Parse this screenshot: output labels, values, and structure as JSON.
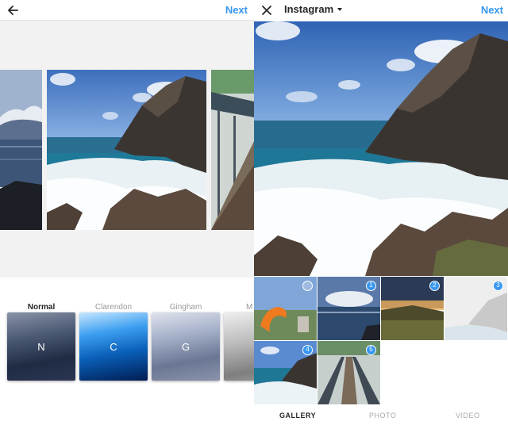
{
  "colors": {
    "accent": "#3897f0",
    "text": "#262626",
    "muted": "#9a9a9a"
  },
  "editor": {
    "back_icon": "arrow-left-icon",
    "next_label": "Next",
    "filters": [
      {
        "name": "Normal",
        "letter": "N"
      },
      {
        "name": "Clarendon",
        "letter": "C"
      },
      {
        "name": "Gingham",
        "letter": "G"
      },
      {
        "name": "M",
        "letter": ""
      }
    ]
  },
  "picker": {
    "close_icon": "close-icon",
    "album_title": "Instagram",
    "next_label": "Next",
    "selection_badges": [
      "1",
      "2",
      "3",
      "4",
      "5"
    ],
    "tabs": [
      {
        "label": "GALLERY"
      },
      {
        "label": "PHOTO"
      },
      {
        "label": "VIDEO"
      }
    ]
  }
}
